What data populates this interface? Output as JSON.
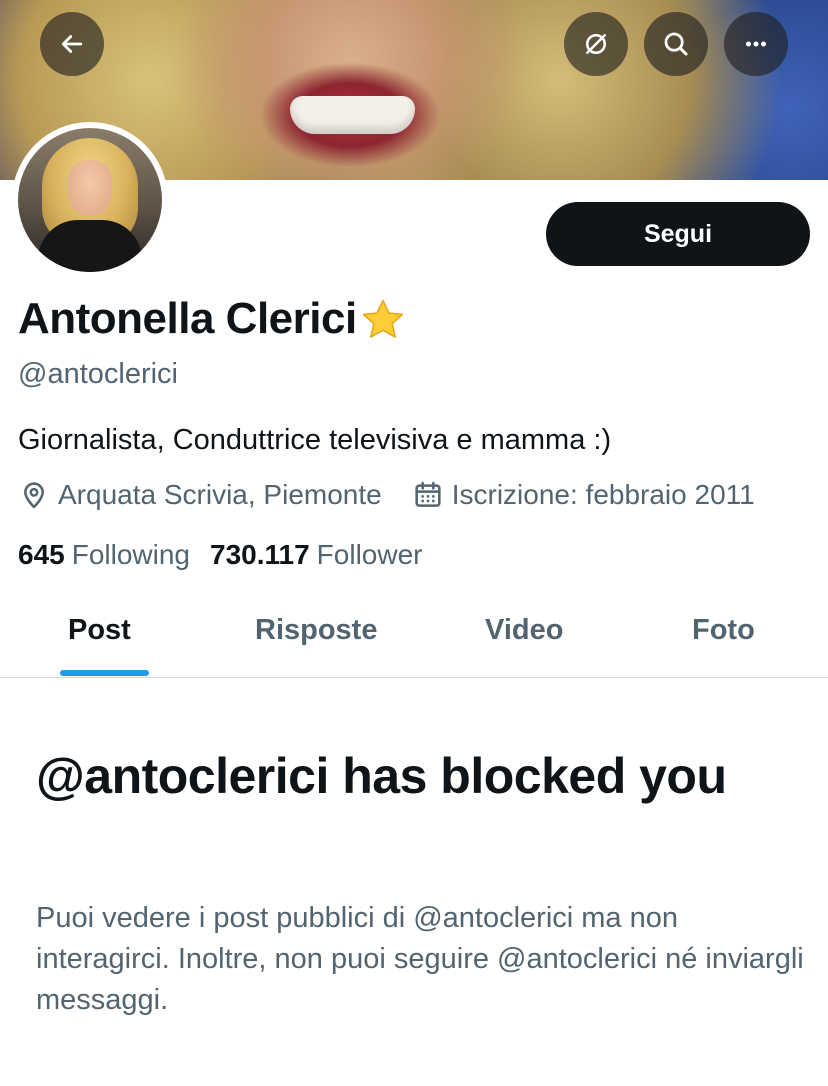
{
  "header": {
    "back_icon": "arrow-left-icon",
    "translate_icon": "translate-icon",
    "search_icon": "search-icon",
    "more_icon": "more-horizontal-icon"
  },
  "profile": {
    "follow_label": "Segui",
    "name": "Antonella Clerici",
    "name_emoji": "star-icon",
    "handle": "@antoclerici",
    "bio": "Giornalista, Conduttrice televisiva e mamma :)",
    "location": "Arquata Scrivia, Piemonte",
    "joined": "Iscrizione: febbraio 2011",
    "following_count": "645",
    "following_label": "Following",
    "followers_count": "730.117",
    "followers_label": "Follower"
  },
  "tabs": [
    {
      "label": "Post",
      "active": true
    },
    {
      "label": "Risposte",
      "active": false
    },
    {
      "label": "Video",
      "active": false
    },
    {
      "label": "Foto",
      "active": false
    }
  ],
  "blocked": {
    "title": "@antoclerici has blocked you",
    "description": "Puoi vedere i post pubblici di @antoclerici ma non interagirci. Inoltre, non puoi seguire @antoclerici né inviargli messaggi."
  },
  "colors": {
    "text_primary": "#0f1419",
    "text_secondary": "#536471",
    "accent": "#1d9bf0",
    "button_bg": "#0f1419"
  }
}
